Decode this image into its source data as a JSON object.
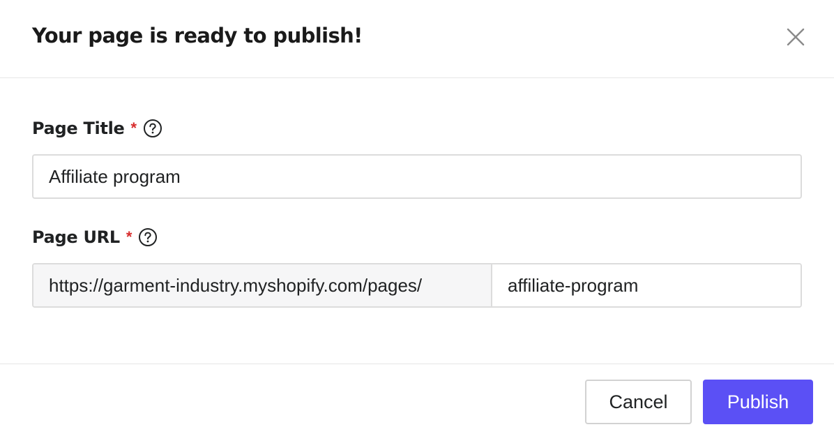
{
  "modal": {
    "title": "Your page is ready to publish!",
    "close_icon": "close-icon"
  },
  "page_title_field": {
    "label": "Page Title",
    "required_marker": "*",
    "help_icon": "question-circle-icon",
    "value": "Affiliate program"
  },
  "page_url_field": {
    "label": "Page URL",
    "required_marker": "*",
    "help_icon": "question-circle-icon",
    "prefix": "https://garment-industry.myshopify.com/pages/",
    "value": "affiliate-program"
  },
  "footer": {
    "cancel_label": "Cancel",
    "publish_label": "Publish"
  },
  "colors": {
    "primary": "#5b50f5",
    "required": "#d72c2c",
    "border": "#dcdcdc",
    "prefix_bg": "#f6f6f7"
  }
}
